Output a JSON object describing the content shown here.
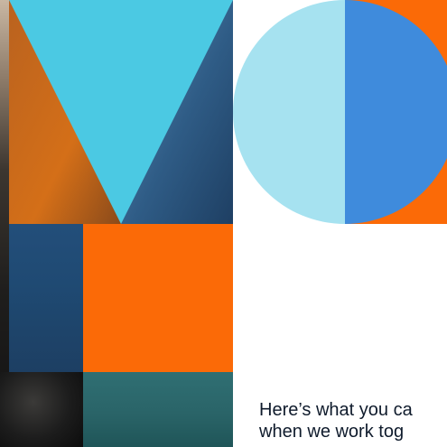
{
  "colors": {
    "cyan": "#4bc9e3",
    "light_blue": "#a6e2f0",
    "blue": "#3f8bdc",
    "orange": "#fb6a07",
    "teal": "#2a6468",
    "navy": "#234e7a"
  },
  "tagline": {
    "text": "Here’s what you ca\nwhen we work tog"
  }
}
